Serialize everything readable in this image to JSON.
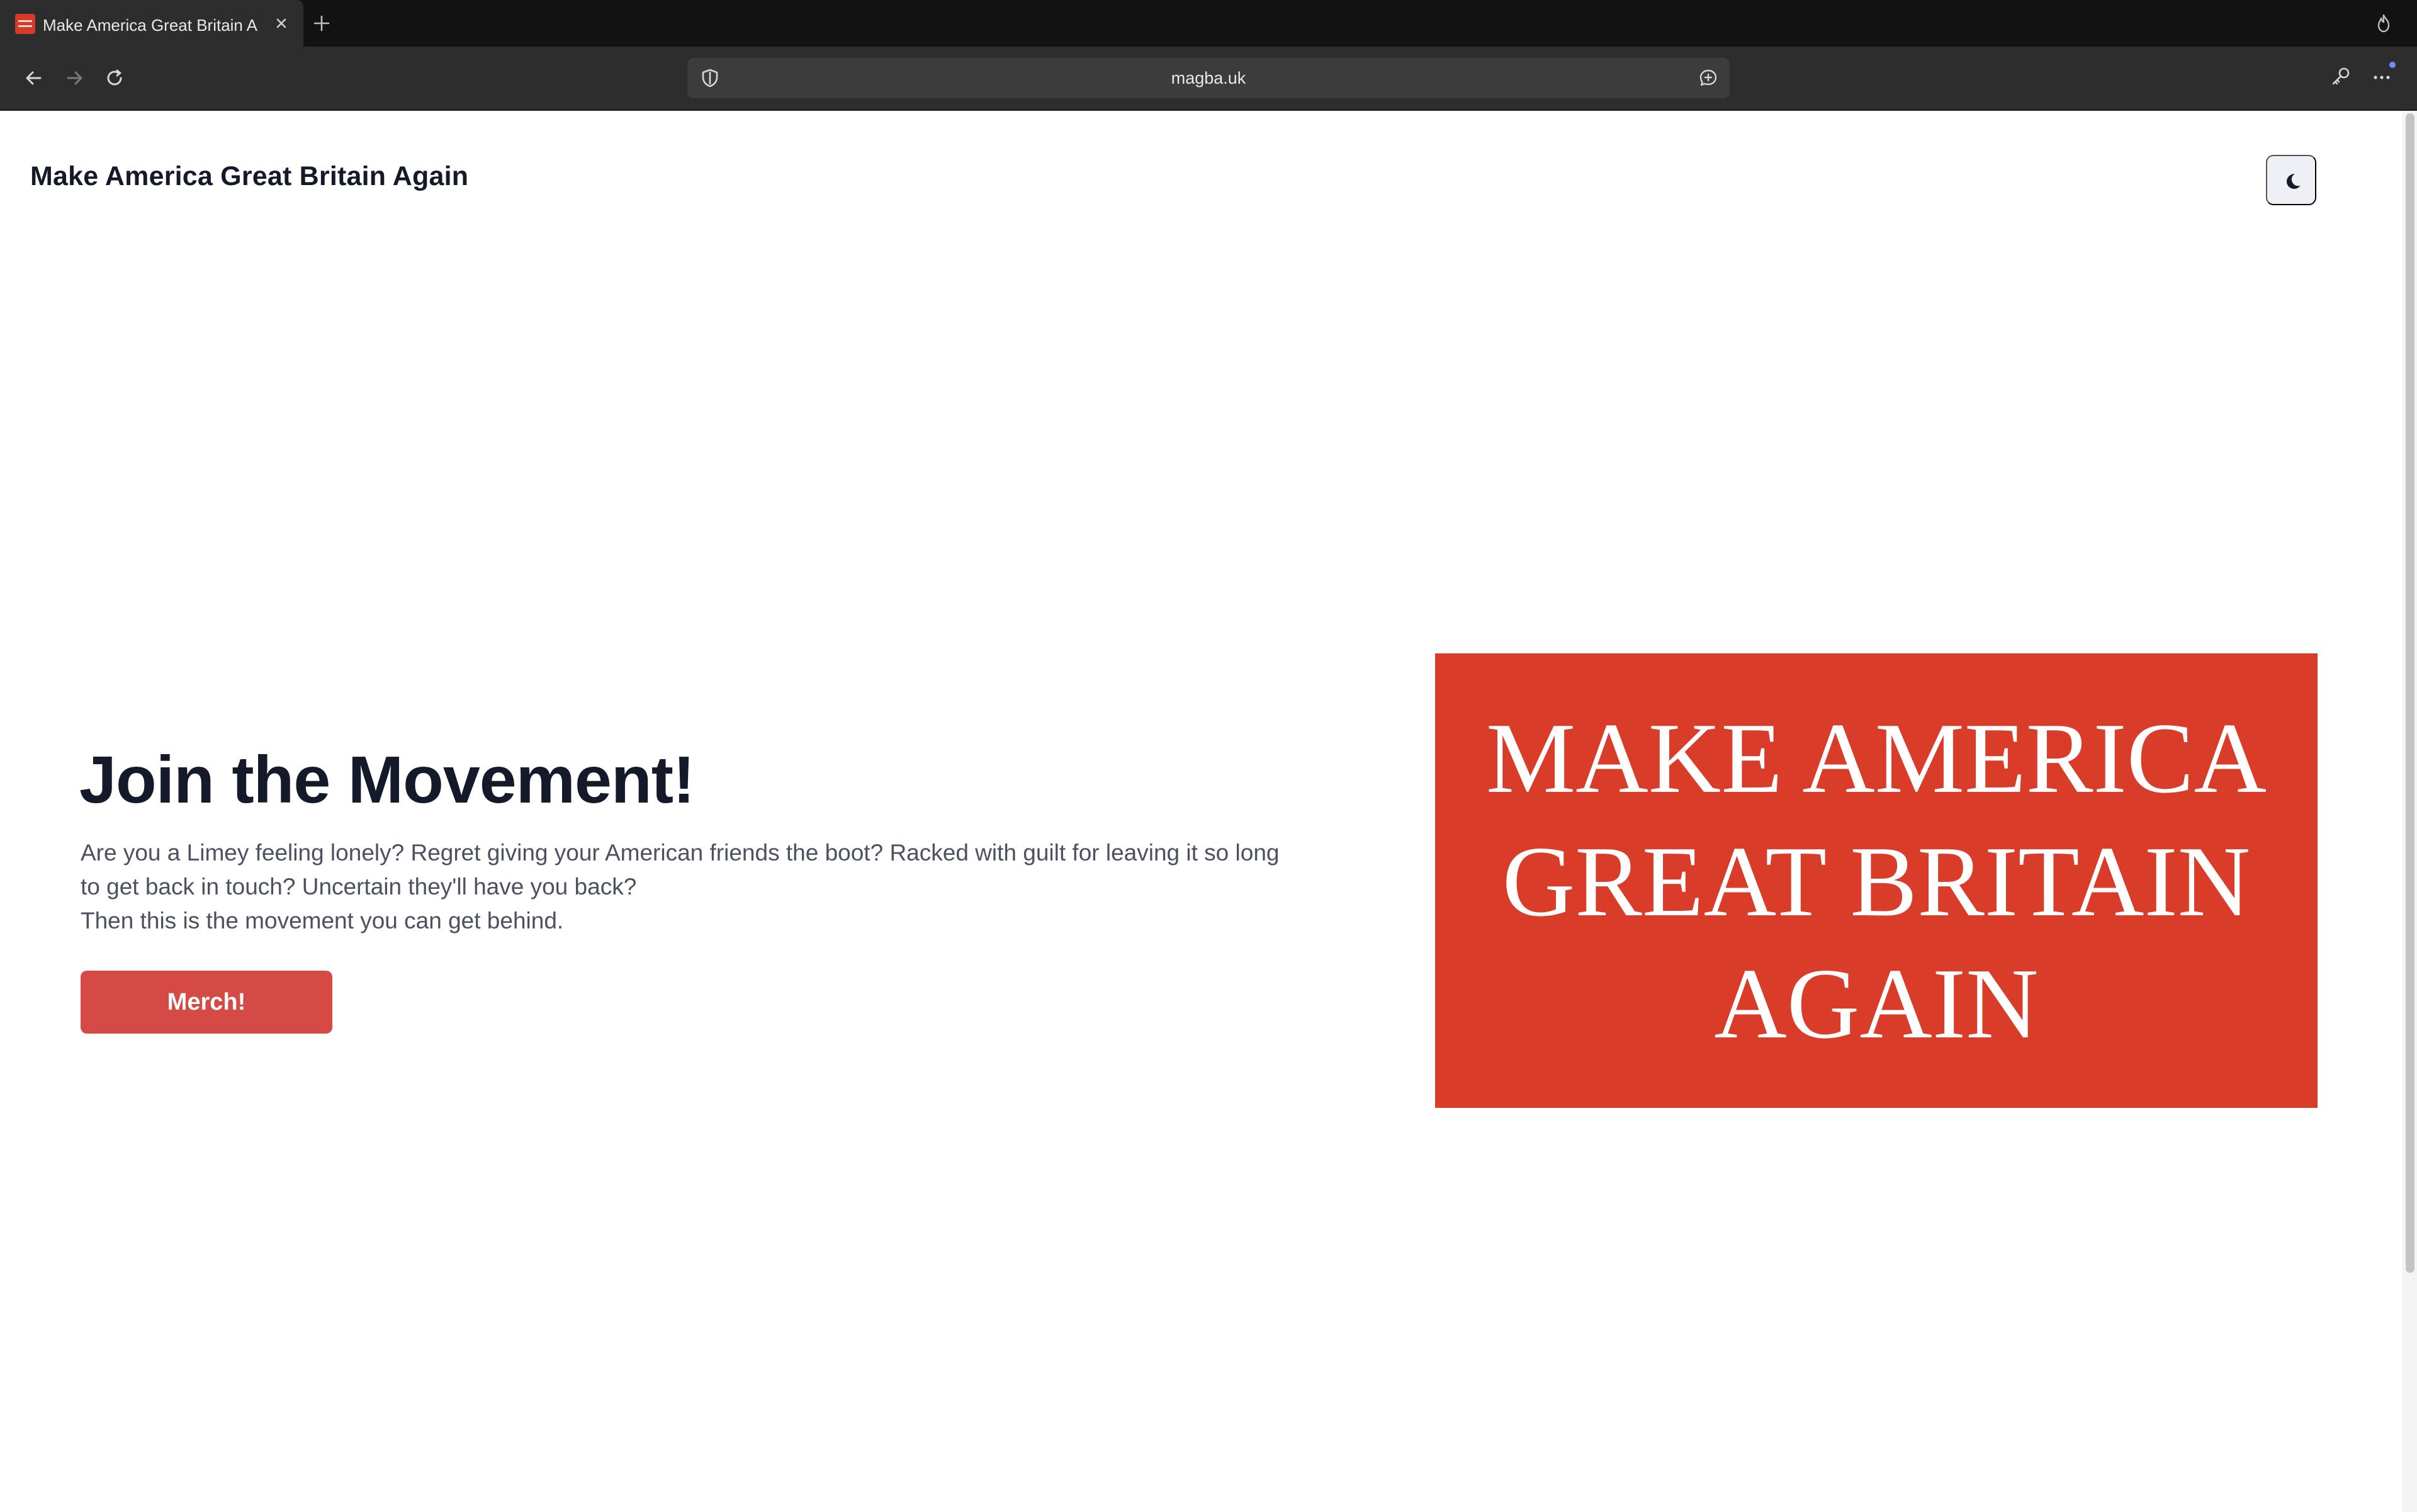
{
  "browser": {
    "tab_title": "Make America Great Britain A",
    "url": "magba.uk",
    "accent_color": "#6e8cff"
  },
  "site": {
    "title": "Make America Great Britain Again",
    "theme_toggle_icon": "moon-icon"
  },
  "hero": {
    "heading": "Join the Movement!",
    "paragraph_lines": [
      "Are you a Limey feeling lonely? Regret giving your American friends the boot? Racked with guilt for leaving it so long",
      "to get back in touch? Uncertain they'll have you back?",
      "Then this is the movement you can get behind."
    ],
    "button_label": "Merch!",
    "button_color": "#d64a45"
  },
  "banner": {
    "lines": [
      "MAKE AMERICA",
      "GREAT BRITAIN",
      "AGAIN"
    ],
    "background_color": "#d93c28"
  }
}
